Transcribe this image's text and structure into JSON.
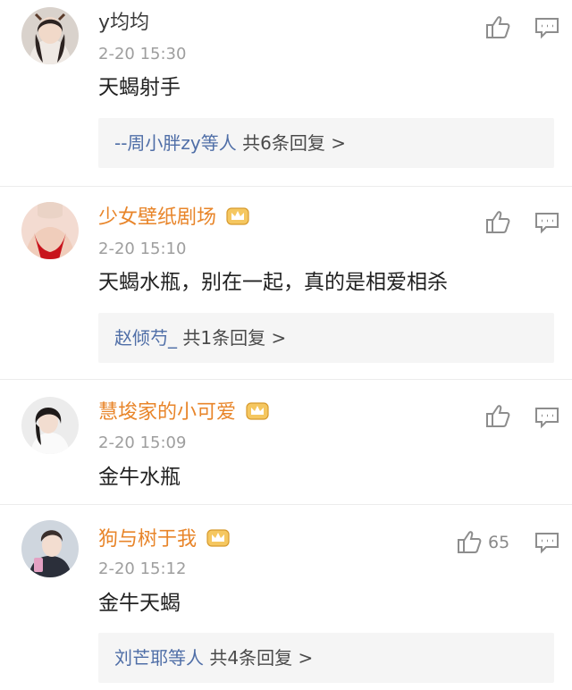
{
  "comments": [
    {
      "username": "y均均",
      "vip": false,
      "time": "2-20 15:30",
      "text": "天蝎射手",
      "replies": {
        "names": "--周小胖zy等人",
        "count": "共6条回复 >"
      },
      "likes": ""
    },
    {
      "username": "少女壁纸剧场",
      "vip": true,
      "time": "2-20 15:10",
      "text": "天蝎水瓶，别在一起，真的是相爱相杀",
      "replies": {
        "names": "赵倾芍_",
        "count": "共1条回复 >"
      },
      "likes": ""
    },
    {
      "username": "慧埈家的小可爱",
      "vip": true,
      "time": "2-20 15:09",
      "text": "金牛水瓶",
      "replies": null,
      "likes": ""
    },
    {
      "username": "狗与树于我",
      "vip": true,
      "time": "2-20 15:12",
      "text": "金牛天蝎",
      "replies": {
        "names": "刘芒耶等人",
        "count": "共4条回复 >"
      },
      "likes": "65"
    }
  ],
  "icons": {
    "like": "thumbs-up-icon",
    "reply": "comment-icon",
    "vip": "crown-icon"
  },
  "colors": {
    "vip_name": "#e8852a",
    "reply_link": "#4f6ea7",
    "meta": "#9e9e9e"
  }
}
